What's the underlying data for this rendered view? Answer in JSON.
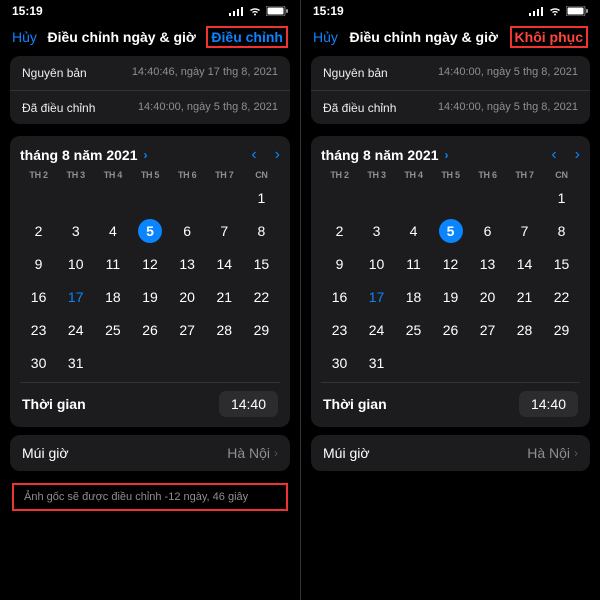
{
  "status": {
    "time": "15:19"
  },
  "nav": {
    "cancel": "Hủy",
    "title": "Điều chỉnh ngày & giờ",
    "action_adjust": "Điều chỉnh",
    "action_restore": "Khôi phục"
  },
  "info": {
    "original_label": "Nguyên bản",
    "original_value_long": "14:40:46, ngày 17 thg 8, 2021",
    "original_value_short": "14:40:00, ngày 5 thg 8, 2021",
    "adjusted_label": "Đã điều chỉnh",
    "adjusted_value": "14:40:00, ngày 5 thg 8, 2021"
  },
  "calendar": {
    "month": "tháng 8 năm 2021",
    "dow": [
      "TH 2",
      "TH 3",
      "TH 4",
      "TH 5",
      "TH 6",
      "TH 7",
      "CN"
    ],
    "lead_blanks": 6,
    "days": 31,
    "selected": 5,
    "today": 17
  },
  "time": {
    "label": "Thời gian",
    "value": "14:40"
  },
  "tz": {
    "label": "Múi giờ",
    "value": "Hà Nội"
  },
  "footer": {
    "note": "Ảnh gốc sẽ được điều chỉnh -12 ngày, 46 giây"
  }
}
